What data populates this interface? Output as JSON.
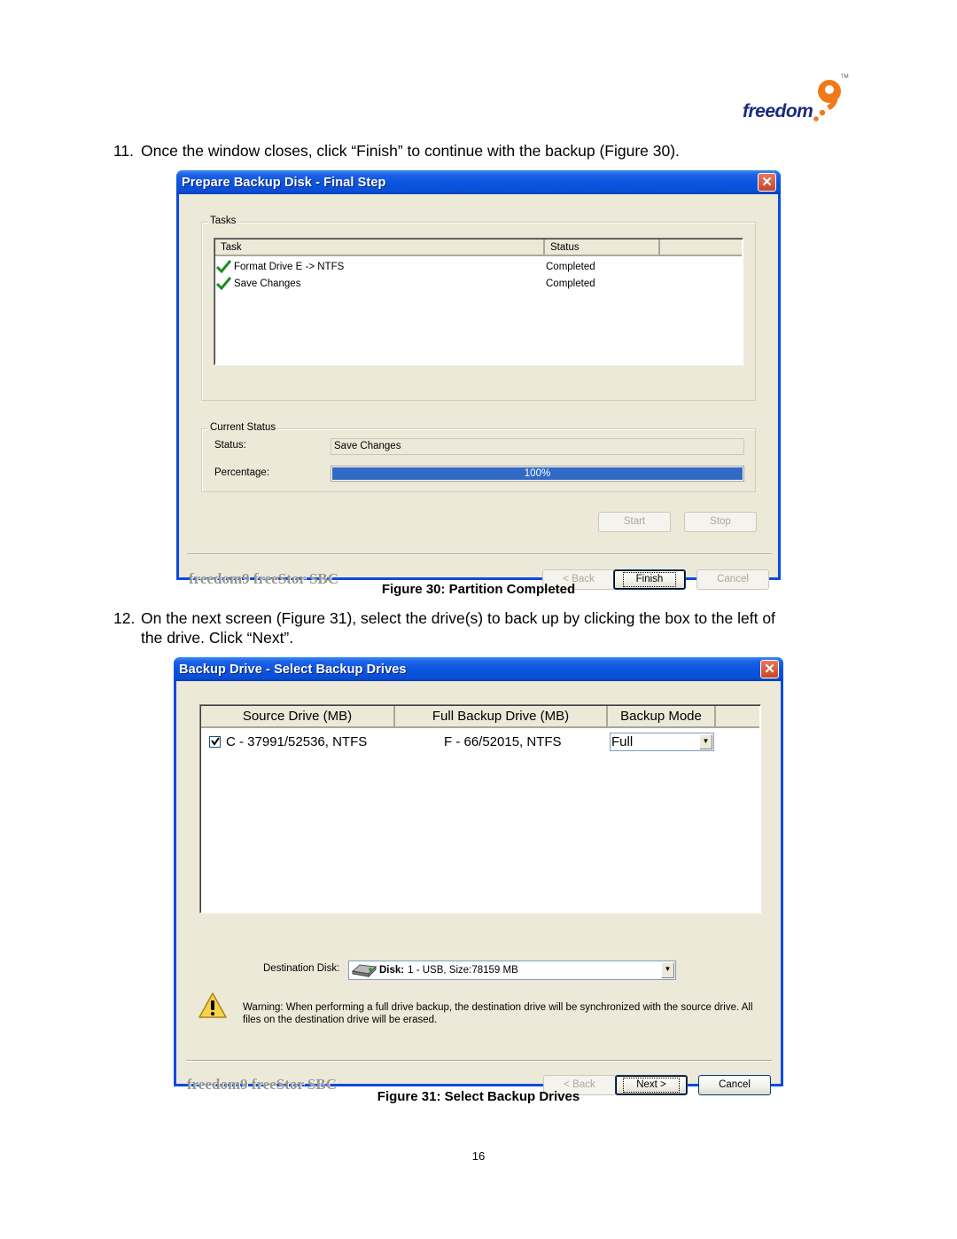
{
  "logo": {
    "text": "freedom",
    "mark": "9",
    "tm": "TM"
  },
  "steps": [
    {
      "number": "11.",
      "text": "Once the window closes, click “Finish” to continue with the backup (Figure 30)."
    },
    {
      "number": "12.",
      "line1": "On the next screen (Figure 31), select the drive(s) to back up by clicking the box to the left of",
      "line2": "the drive.  Click “Next”."
    }
  ],
  "figure30": {
    "caption": "Figure 30: Partition Completed",
    "window_title": "Prepare Backup Disk - Final Step",
    "tasks_group": "Tasks",
    "columns": [
      "Task",
      "Status",
      ""
    ],
    "rows": [
      {
        "icon": "green-check-icon",
        "task": "Format Drive E -> NTFS",
        "status": "Completed"
      },
      {
        "icon": "green-check-icon",
        "task": "Save Changes",
        "status": "Completed"
      }
    ],
    "current_status_group": "Current Status",
    "status_label": "Status:",
    "status_value": "Save Changes",
    "percentage_label": "Percentage:",
    "progress_percent": 100,
    "progress_text": "100%",
    "start_button": "Start",
    "stop_button": "Stop",
    "brand": "freedom9 freeStor SBC",
    "back_button": "< Back",
    "finish_button": "Finish",
    "cancel_button": "Cancel"
  },
  "figure31": {
    "caption": "Figure 31: Select Backup Drives",
    "window_title": "Backup Drive - Select Backup Drives",
    "columns": [
      "Source Drive (MB)",
      "Full Backup Drive (MB)",
      "Backup Mode"
    ],
    "rows": [
      {
        "checked": true,
        "source": "C - 37991/52536, NTFS",
        "backup": "F - 66/52015, NTFS",
        "mode": "Full"
      }
    ],
    "destination_label": "Destination Disk:",
    "destination_bold": "Disk:",
    "destination_value": "1 - USB, Size:78159 MB",
    "warning_line1": "Warning: When performing a full drive backup, the destination drive will be synchronized with the source drive. All",
    "warning_line2": "files on the destination drive will be erased.",
    "brand": "freedom9 freeStor SBC",
    "back_button": "< Back",
    "next_button": "Next >",
    "cancel_button": "Cancel"
  },
  "page_number": "16",
  "colors": {
    "titlebar": "#0b55e0",
    "dialog_bg": "#ece9d8",
    "progress_fill": "#316ac5",
    "logo_blue": "#1d2a80",
    "logo_orange": "#f07a1a"
  }
}
